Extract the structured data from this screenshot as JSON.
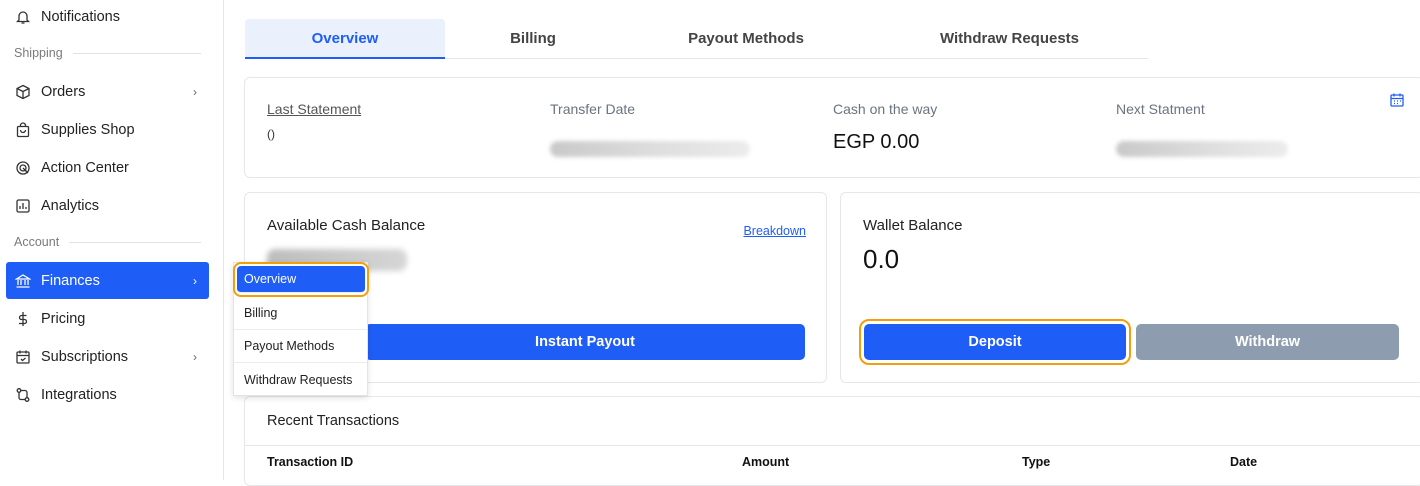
{
  "sidebar": {
    "items": [
      {
        "label": "Notifications",
        "icon": "bell-icon"
      },
      {
        "label": "Orders",
        "icon": "box-icon",
        "chevron": "›"
      },
      {
        "label": "Supplies Shop",
        "icon": "shopping-bag-icon"
      },
      {
        "label": "Action Center",
        "icon": "radar-icon"
      },
      {
        "label": "Analytics",
        "icon": "chart-icon"
      },
      {
        "label": "Finances",
        "icon": "bank-icon",
        "chevron": "›"
      },
      {
        "label": "Pricing",
        "icon": "dollar-icon"
      },
      {
        "label": "Subscriptions",
        "icon": "calendar-check-icon",
        "chevron": "›"
      },
      {
        "label": "Integrations",
        "icon": "integrations-icon"
      }
    ],
    "sections": {
      "shipping": "Shipping",
      "account": "Account"
    }
  },
  "flyout": {
    "items": [
      "Overview",
      "Billing",
      "Payout Methods",
      "Withdraw Requests"
    ]
  },
  "tabs": [
    "Overview",
    "Billing",
    "Payout Methods",
    "Withdraw Requests"
  ],
  "statement": {
    "last_statement_label": "Last Statement",
    "last_statement_value": "()",
    "transfer_date_label": "Transfer Date",
    "cash_on_way_label": "Cash on the way",
    "cash_on_way_value": "EGP 0.00",
    "next_statement_label": "Next Statment"
  },
  "available": {
    "title": "Available Cash Balance",
    "breakdown": "Breakdown",
    "payout_button": "Instant Payout"
  },
  "wallet": {
    "title": "Wallet Balance",
    "value": "0.0",
    "deposit_button": "Deposit",
    "withdraw_button": "Withdraw"
  },
  "transactions": {
    "title": "Recent Transactions",
    "columns": [
      "Transaction ID",
      "Amount",
      "Type",
      "Date"
    ]
  },
  "colors": {
    "accent": "#1f5ef6",
    "highlight": "#f59e0b",
    "disabled": "#8e9cb0"
  }
}
